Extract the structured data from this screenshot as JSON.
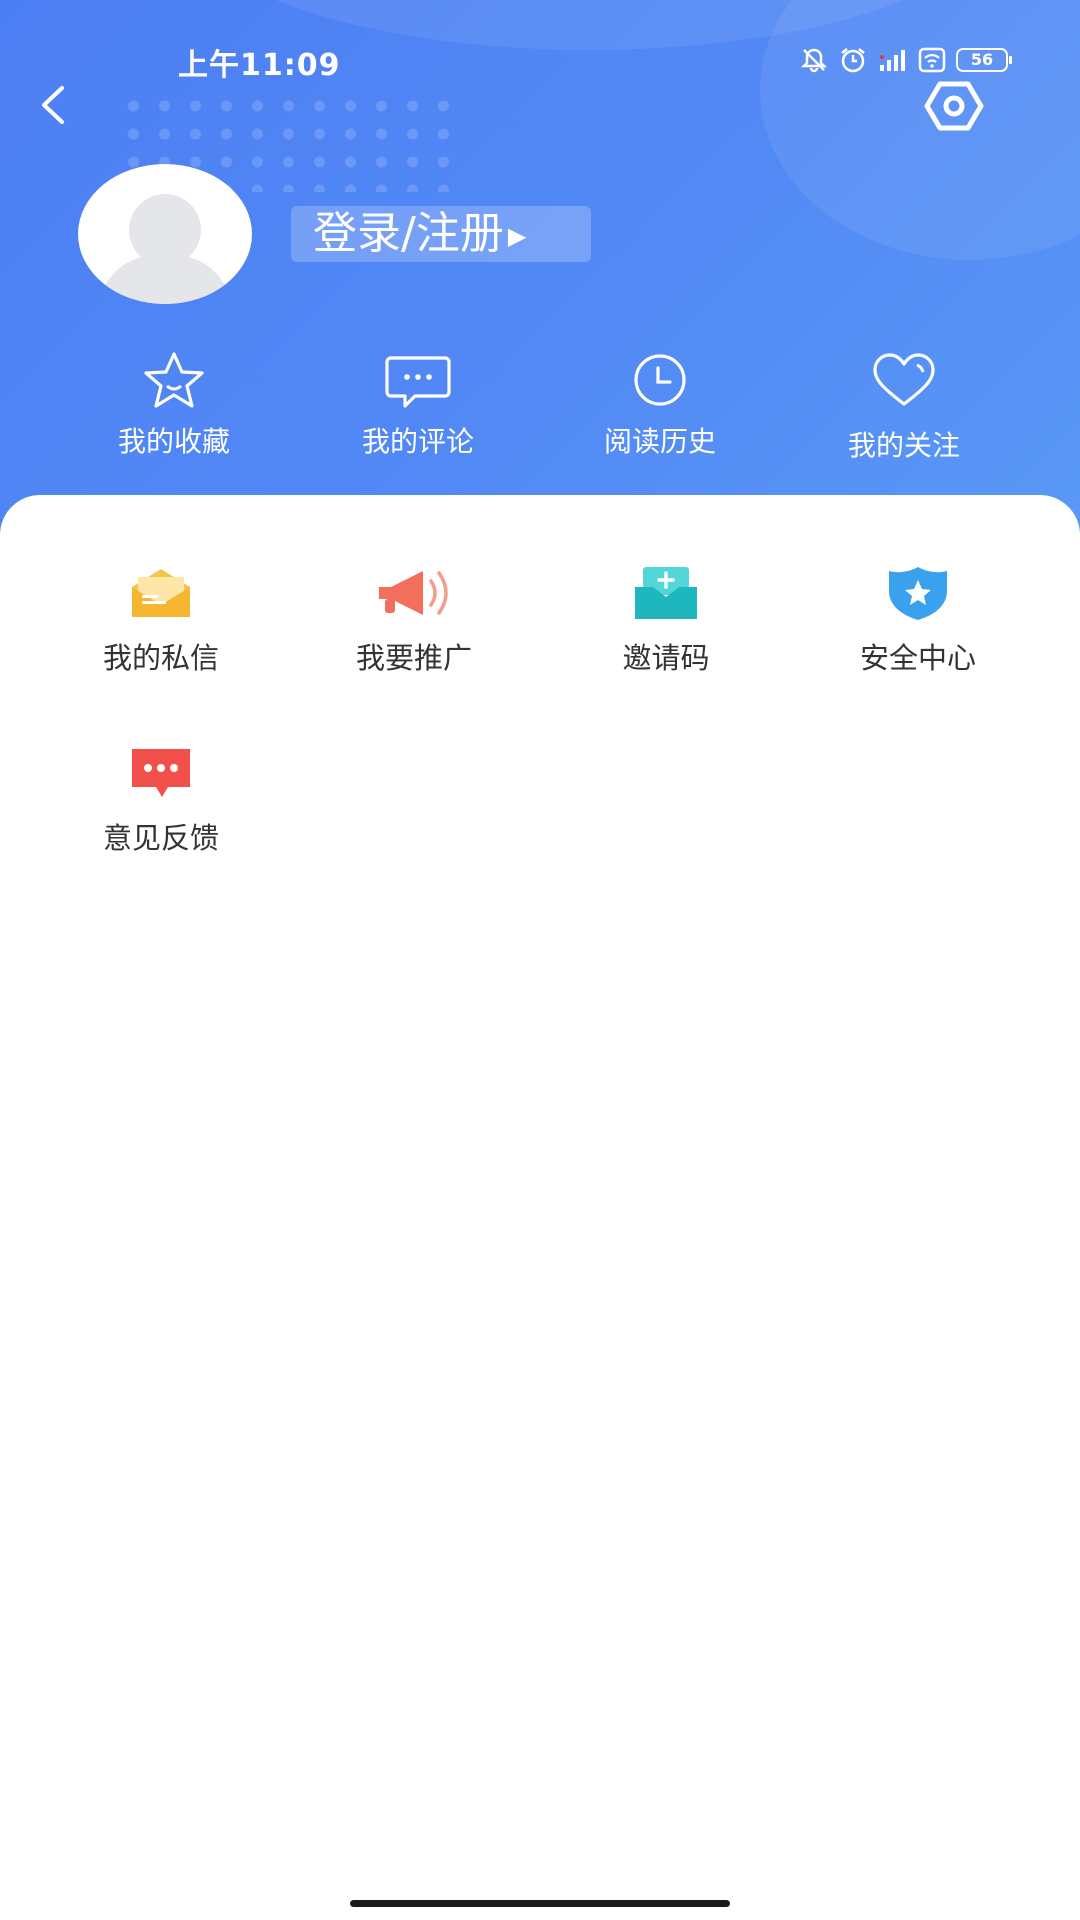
{
  "status_bar": {
    "time": "上午11:09",
    "battery": "56"
  },
  "profile": {
    "login_label": "登录/注册",
    "login_arrow": "▶"
  },
  "quick_actions": [
    {
      "label": "我的收藏",
      "icon": "star-icon"
    },
    {
      "label": "我的评论",
      "icon": "comment-icon"
    },
    {
      "label": "阅读历史",
      "icon": "clock-icon"
    },
    {
      "label": "我的关注",
      "icon": "heart-icon"
    }
  ],
  "menu": [
    {
      "label": "我的私信",
      "icon": "envelope-icon",
      "color": "#f7c44a"
    },
    {
      "label": "我要推广",
      "icon": "megaphone-icon",
      "color": "#f26f5c"
    },
    {
      "label": "邀请码",
      "icon": "invite-box-icon",
      "color": "#23c3c8"
    },
    {
      "label": "安全中心",
      "icon": "shield-icon",
      "color": "#3aa1ee"
    },
    {
      "label": "意见反馈",
      "icon": "feedback-bubble-icon",
      "color": "#f2504b"
    }
  ],
  "colors": {
    "header": "#4f84f5",
    "text": "#333333"
  }
}
